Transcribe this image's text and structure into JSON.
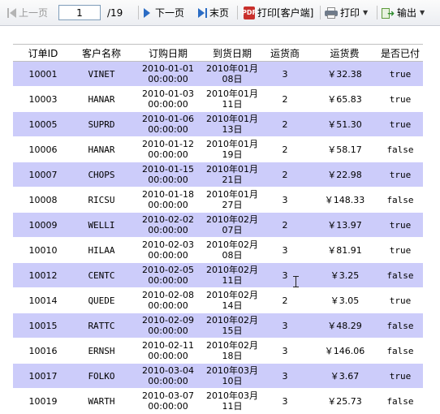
{
  "toolbar": {
    "prev_page": "上一页",
    "current_page": "1",
    "total_pages": "/19",
    "next_page": "下一页",
    "last_page": "末页",
    "pdf_label": "PDF",
    "print_client": "打印[客户端]",
    "print": "打印",
    "export": "输出"
  },
  "table": {
    "headers": [
      "订单ID",
      "客户名称",
      "订购日期",
      "到货日期",
      "运货商",
      "运货费",
      "是否已付"
    ],
    "rows": [
      {
        "id": "10001",
        "customer": "VINET",
        "order_date": "2010-01-01",
        "order_time": "00:00:00",
        "arrive_date": "2010年01月",
        "arrive_day": "08日",
        "shipper": "3",
        "freight": "￥32.38",
        "paid": "true"
      },
      {
        "id": "10003",
        "customer": "HANAR",
        "order_date": "2010-01-03",
        "order_time": "00:00:00",
        "arrive_date": "2010年01月",
        "arrive_day": "11日",
        "shipper": "2",
        "freight": "￥65.83",
        "paid": "true"
      },
      {
        "id": "10005",
        "customer": "SUPRD",
        "order_date": "2010-01-06",
        "order_time": "00:00:00",
        "arrive_date": "2010年01月",
        "arrive_day": "13日",
        "shipper": "2",
        "freight": "￥51.30",
        "paid": "true"
      },
      {
        "id": "10006",
        "customer": "HANAR",
        "order_date": "2010-01-12",
        "order_time": "00:00:00",
        "arrive_date": "2010年01月",
        "arrive_day": "19日",
        "shipper": "2",
        "freight": "￥58.17",
        "paid": "false"
      },
      {
        "id": "10007",
        "customer": "CHOPS",
        "order_date": "2010-01-15",
        "order_time": "00:00:00",
        "arrive_date": "2010年01月",
        "arrive_day": "21日",
        "shipper": "2",
        "freight": "￥22.98",
        "paid": "true"
      },
      {
        "id": "10008",
        "customer": "RICSU",
        "order_date": "2010-01-18",
        "order_time": "00:00:00",
        "arrive_date": "2010年01月",
        "arrive_day": "27日",
        "shipper": "3",
        "freight": "￥148.33",
        "paid": "false"
      },
      {
        "id": "10009",
        "customer": "WELLI",
        "order_date": "2010-02-02",
        "order_time": "00:00:00",
        "arrive_date": "2010年02月",
        "arrive_day": "07日",
        "shipper": "2",
        "freight": "￥13.97",
        "paid": "true"
      },
      {
        "id": "10010",
        "customer": "HILAA",
        "order_date": "2010-02-03",
        "order_time": "00:00:00",
        "arrive_date": "2010年02月",
        "arrive_day": "08日",
        "shipper": "3",
        "freight": "￥81.91",
        "paid": "true"
      },
      {
        "id": "10012",
        "customer": "CENTC",
        "order_date": "2010-02-05",
        "order_time": "00:00:00",
        "arrive_date": "2010年02月",
        "arrive_day": "11日",
        "shipper": "3",
        "freight": "￥3.25",
        "paid": "false"
      },
      {
        "id": "10014",
        "customer": "QUEDE",
        "order_date": "2010-02-08",
        "order_time": "00:00:00",
        "arrive_date": "2010年02月",
        "arrive_day": "14日",
        "shipper": "2",
        "freight": "￥3.05",
        "paid": "true"
      },
      {
        "id": "10015",
        "customer": "RATTC",
        "order_date": "2010-02-09",
        "order_time": "00:00:00",
        "arrive_date": "2010年02月",
        "arrive_day": "15日",
        "shipper": "3",
        "freight": "￥48.29",
        "paid": "false"
      },
      {
        "id": "10016",
        "customer": "ERNSH",
        "order_date": "2010-02-11",
        "order_time": "00:00:00",
        "arrive_date": "2010年02月",
        "arrive_day": "18日",
        "shipper": "3",
        "freight": "￥146.06",
        "paid": "false"
      },
      {
        "id": "10017",
        "customer": "FOLKO",
        "order_date": "2010-03-04",
        "order_time": "00:00:00",
        "arrive_date": "2010年03月",
        "arrive_day": "10日",
        "shipper": "3",
        "freight": "￥3.67",
        "paid": "true"
      },
      {
        "id": "10019",
        "customer": "WARTH",
        "order_date": "2010-03-07",
        "order_time": "00:00:00",
        "arrive_date": "2010年03月",
        "arrive_day": "11日",
        "shipper": "3",
        "freight": "￥25.73",
        "paid": "false"
      }
    ]
  },
  "colors": {
    "band_row": "#ccccfa",
    "plain_row": "#ffffff",
    "toolbar_icon": "#2b6cc4"
  }
}
